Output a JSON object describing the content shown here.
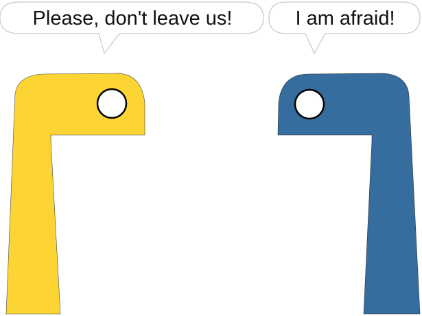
{
  "left_character": {
    "speech": "Please, don't leave us!",
    "body_color": "#FCD535",
    "eye_color": "#FFFFFF"
  },
  "right_character": {
    "speech": "I am afraid!",
    "body_color": "#356D9E",
    "eye_color": "#FFFFFF"
  },
  "colors": {
    "bubble_fill": "#FFFFFF",
    "bubble_stroke": "#C8C8C8",
    "outline": "#000000"
  }
}
